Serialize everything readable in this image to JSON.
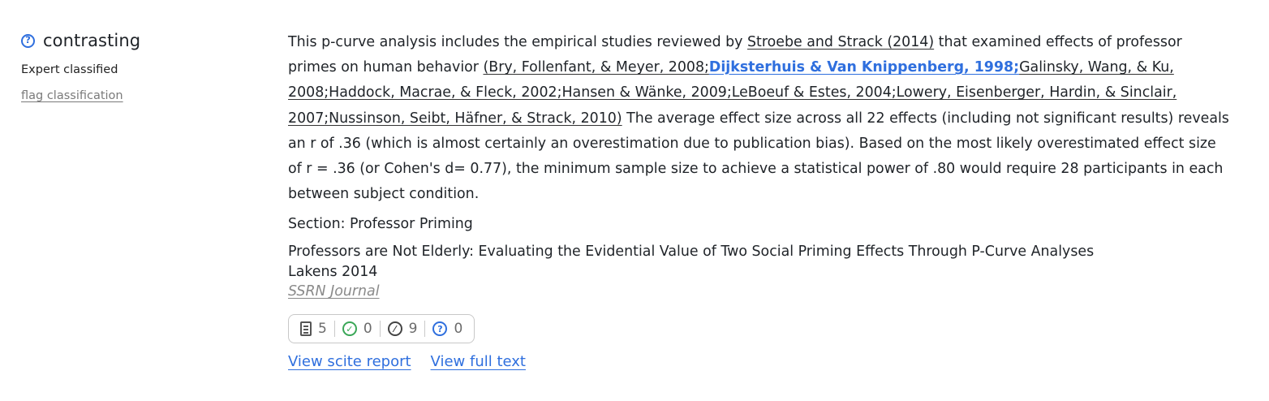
{
  "classification": {
    "icon": "question-circle-icon",
    "label": "contrasting",
    "source": "Expert classified",
    "flag_link": "flag classification"
  },
  "snippet": {
    "pre": "This p-curve analysis includes the empirical studies reviewed by ",
    "cite_1": "Stroebe and Strack (2014)",
    "mid": " that examined effects of professor primes on human behavior ",
    "cite_2": "(Bry, Follenfant, & Meyer, 2008;",
    "target": "Dijksterhuis & Van Knippenberg, 1998;",
    "cite_3": "Galinsky, Wang, & Ku, 2008;Haddock, Macrae, & Fleck, 2002;Hansen & Wänke, 2009;LeBoeuf & Estes, 2004;Lowery, Eisenberger, Hardin, & Sinclair, 2007;Nussinson, Seibt, Häfner, & Strack, 2010)",
    "post": " The average effect size across all 22 effects (including not significant results) reveals an r of .36 (which is almost certainly an overestimation due to publication bias). Based on the most likely overestimated effect size of r = .36 (or Cohen's d= 0.77), the minimum sample size to achieve a statistical power of .80 would require 28 participants in each between subject condition."
  },
  "section": "Section: Professor Priming",
  "paper": {
    "title": "Professors are Not Elderly: Evaluating the Evidential Value of Two Social Priming Effects Through P-Curve Analyses",
    "authors": "Lakens 2014",
    "journal": "SSRN Journal"
  },
  "tally": {
    "mentioning": "5",
    "supporting": "0",
    "contrasting": "9",
    "unclassified": "0"
  },
  "colors": {
    "accent": "#2f6fde",
    "supporting": "#3aa757",
    "muted": "#7a7a7a"
  },
  "actions": {
    "view_report": "View scite report",
    "view_full_text": "View full text"
  }
}
